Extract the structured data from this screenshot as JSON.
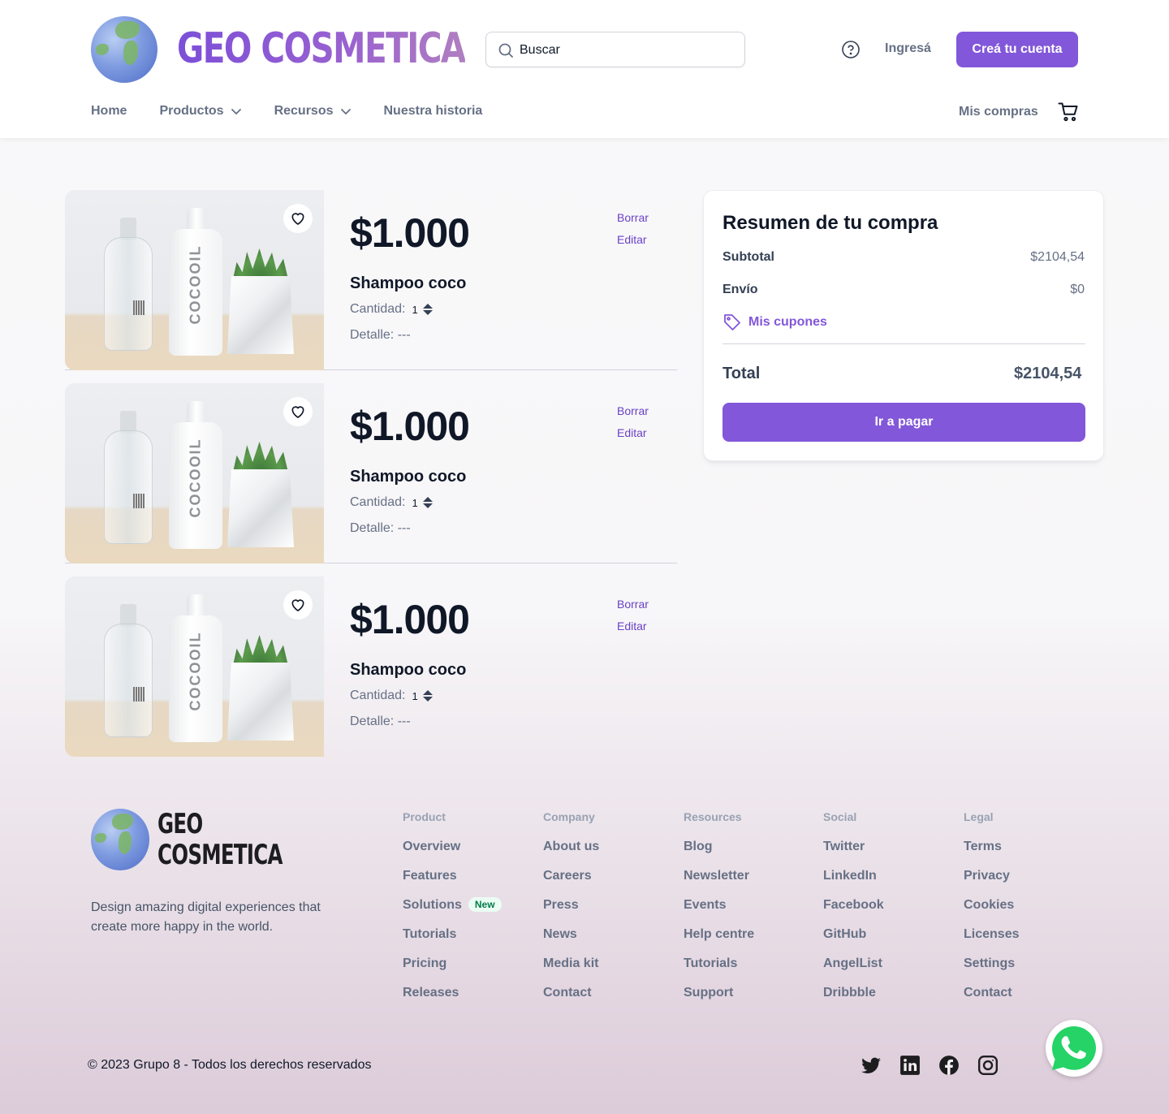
{
  "header": {
    "brand": "GEO COSMETICA",
    "search_placeholder": "Buscar",
    "login_label": "Ingresá",
    "signup_label": "Creá tu cuenta",
    "nav": [
      {
        "label": "Home"
      },
      {
        "label": "Productos"
      },
      {
        "label": "Recursos"
      },
      {
        "label": "Nuestra historia"
      }
    ],
    "my_purchases_label": "Mis compras",
    "icons": [
      "search-icon",
      "help-icon",
      "chevron-down-icon",
      "cart-icon"
    ]
  },
  "cart": {
    "items": [
      {
        "price": "$1.000",
        "name": "Shampoo coco",
        "qty_label": "Cantidad:",
        "qty": "1",
        "detail": "Detalle: ---",
        "delete_label": "Borrar",
        "edit_label": "Editar",
        "image_text": "COCOOIL"
      },
      {
        "price": "$1.000",
        "name": "Shampoo coco",
        "qty_label": "Cantidad:",
        "qty": "1",
        "detail": "Detalle: ---",
        "delete_label": "Borrar",
        "edit_label": "Editar",
        "image_text": "COCOOIL"
      },
      {
        "price": "$1.000",
        "name": "Shampoo coco",
        "qty_label": "Cantidad:",
        "qty": "1",
        "detail": "Detalle: ---",
        "delete_label": "Borrar",
        "edit_label": "Editar",
        "image_text": "COCOOIL"
      }
    ]
  },
  "summary": {
    "title": "Resumen de tu compra",
    "subtotal_label": "Subtotal",
    "subtotal_value": "$2104,54",
    "shipping_label": "Envío",
    "shipping_value": "$0",
    "coupons_label": "Mis cupones",
    "total_label": "Total",
    "total_value": "$2104,54",
    "pay_label": "Ir a pagar"
  },
  "footer": {
    "brand_line1": "GEO",
    "brand_line2": "COSMETICA",
    "tagline": "Design amazing digital experiences that create more happy in the world.",
    "columns": [
      {
        "heading": "Product",
        "links": [
          "Overview",
          "Features",
          "Solutions",
          "Tutorials",
          "Pricing",
          "Releases"
        ]
      },
      {
        "heading": "Company",
        "links": [
          "About us",
          "Careers",
          "Press",
          "News",
          "Media kit",
          "Contact"
        ]
      },
      {
        "heading": "Resources",
        "links": [
          "Blog",
          "Newsletter",
          "Events",
          "Help centre",
          "Tutorials",
          "Support"
        ]
      },
      {
        "heading": "Social",
        "links": [
          "Twitter",
          "LinkedIn",
          "Facebook",
          "GitHub",
          "AngelList",
          "Dribbble"
        ]
      },
      {
        "heading": "Legal",
        "links": [
          "Terms",
          "Privacy",
          "Cookies",
          "Licenses",
          "Settings",
          "Contact"
        ]
      }
    ],
    "new_badge": "New",
    "copyright": "© 2023 Grupo 8 - Todos los derechos reservados",
    "social_icons": [
      "twitter-icon",
      "linkedin-icon",
      "facebook-icon",
      "instagram-icon"
    ]
  },
  "colors": {
    "accent": "#8257d9",
    "link": "#6941c6",
    "text": "#101828",
    "muted": "#667085",
    "whatsapp": "#25d366"
  }
}
